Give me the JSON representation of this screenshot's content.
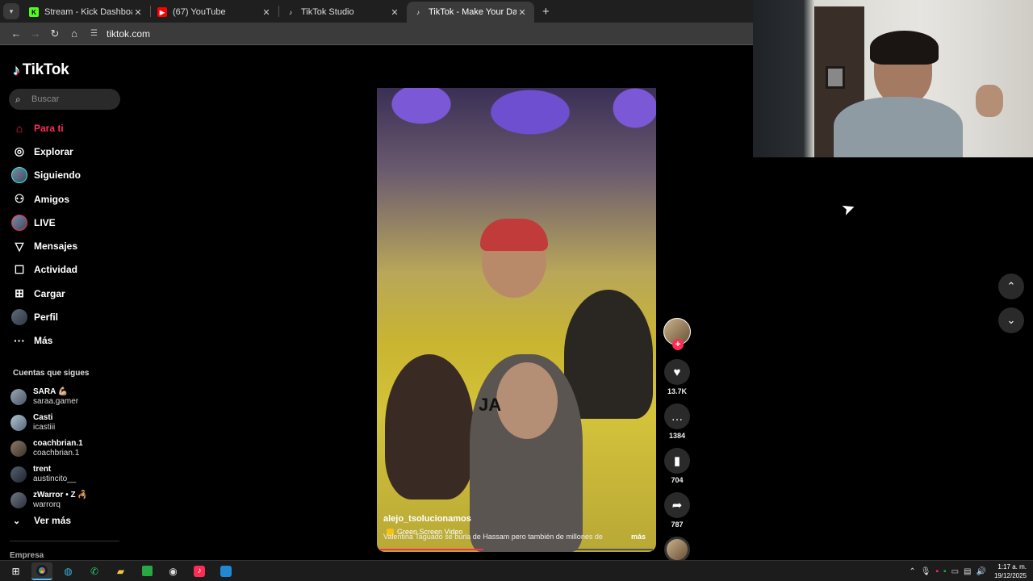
{
  "browser": {
    "tabs": [
      {
        "title": "Stream - Kick Dashboard",
        "icon": "kick-icon",
        "color": "#53fc18",
        "active": false
      },
      {
        "title": "(67) YouTube",
        "icon": "youtube-icon",
        "color": "#ff0000",
        "active": false
      },
      {
        "title": "TikTok Studio",
        "icon": "tiktok-icon",
        "color": "#ffffff",
        "active": false
      },
      {
        "title": "TikTok - Make Your Day",
        "icon": "tiktok-icon",
        "color": "#ffffff",
        "active": true
      }
    ],
    "url": "tiktok.com"
  },
  "sidebar": {
    "brand": "TikTok",
    "search_placeholder": "Buscar",
    "nav": [
      {
        "label": "Para ti",
        "icon": "home-icon",
        "active": true
      },
      {
        "label": "Explorar",
        "icon": "compass-icon"
      },
      {
        "label": "Siguiendo",
        "icon": "following-avatar-icon"
      },
      {
        "label": "Amigos",
        "icon": "friends-icon"
      },
      {
        "label": "LIVE",
        "icon": "live-avatar-icon"
      },
      {
        "label": "Mensajes",
        "icon": "send-icon"
      },
      {
        "label": "Actividad",
        "icon": "activity-icon"
      },
      {
        "label": "Cargar",
        "icon": "upload-icon"
      },
      {
        "label": "Perfil",
        "icon": "profile-avatar-icon"
      },
      {
        "label": "Más",
        "icon": "more-icon"
      }
    ],
    "following_title": "Cuentas que sigues",
    "following": [
      {
        "name": "SARA 💪🏼",
        "user": "saraa.gamer"
      },
      {
        "name": "Casti",
        "user": "icastiii"
      },
      {
        "name": "coachbrian.1",
        "user": "coachbrian.1"
      },
      {
        "name": "trent",
        "user": "austincito__"
      },
      {
        "name": "zWarror • Z 🦂",
        "user": "warrorq"
      }
    ],
    "see_more": "Ver más",
    "footer_section": "Empresa"
  },
  "video": {
    "badge": "Green Screen Video",
    "author": "alejo_tsolucionamos",
    "description": "Valentina Taguado se burla de Hassam pero también de millones de",
    "more": "más",
    "progress": 0.38,
    "overlay_text": "JA"
  },
  "actions": {
    "likes": "13.7K",
    "comments": "1384",
    "saves": "704",
    "shares": "787"
  },
  "taskbar": {
    "time": "1:17 a. m.",
    "date": "19/12/2025"
  },
  "colors": {
    "accent": "#fe2c55",
    "tiktok_cyan": "#25f4ee"
  }
}
